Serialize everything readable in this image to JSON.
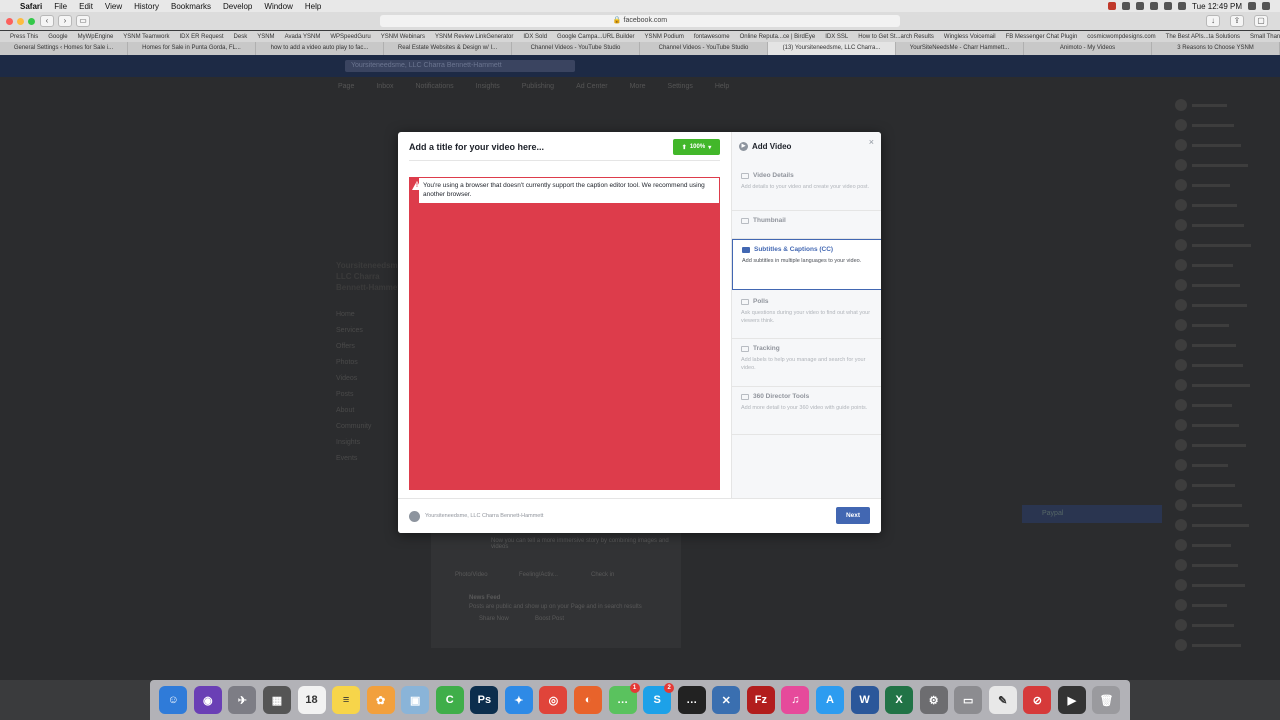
{
  "menubar": {
    "app": "Safari",
    "items": [
      "File",
      "Edit",
      "View",
      "History",
      "Bookmarks",
      "Develop",
      "Window",
      "Help"
    ],
    "clock": "Tue 12:49 PM"
  },
  "browser": {
    "url": "facebook.com",
    "bookmarks": [
      "Press This",
      "Google",
      "MyWpEngine",
      "YSNM Teamwork",
      "IDX ER Request",
      "Desk",
      "YSNM",
      "Avada YSNM",
      "WPSpeedGuru",
      "YSNM Webinars",
      "YSNM Review LinkGenerator",
      "IDX Sold",
      "Google Campa...URL Builder",
      "YSNM Podium",
      "fontawesome",
      "Online Reputa...ce | BirdEye",
      "IDX SSL",
      "How to Get St...arch Results",
      "Wingless Voicemail",
      "FB Messenger Chat Plugin",
      "cosmicwompdesigns.com",
      "The Best APIs...ta Solutions",
      "Small Thanks with Google"
    ],
    "tabs": [
      {
        "label": "General Settings ‹ Homes for Sale i...",
        "active": false
      },
      {
        "label": "Homes for Sale in Punta Gorda, FL...",
        "active": false
      },
      {
        "label": "how to add a video auto play to fac...",
        "active": false
      },
      {
        "label": "Real Estate Websites & Design w/ I...",
        "active": false
      },
      {
        "label": "Channel Videos - YouTube Studio",
        "active": false
      },
      {
        "label": "Channel Videos - YouTube Studio",
        "active": false
      },
      {
        "label": "(13) Yoursiteneedsme, LLC Charra...",
        "active": true
      },
      {
        "label": "YourSiteNeedsMe - Charr Hammett...",
        "active": false
      },
      {
        "label": "Animoto - My Videos",
        "active": false
      },
      {
        "label": "3 Reasons to Choose YSNM",
        "active": false
      }
    ]
  },
  "fb_background": {
    "search_placeholder": "Yoursiteneedsme, LLC Charra Bennett-Hammett",
    "tabs": [
      "Page",
      "Inbox",
      "Notifications",
      "Insights",
      "Publishing",
      "Ad Center",
      "More",
      "Settings",
      "Help"
    ],
    "page_name": "Yoursiteneedsme, LLC Charra Bennett-Hammett",
    "side_items": [
      "Home",
      "Services",
      "Offers",
      "Photos",
      "Videos",
      "Posts",
      "About",
      "Community",
      "Insights",
      "Events"
    ],
    "compose_text": "Now you can tell a more immersive story by combining images and videos",
    "compose_actions": [
      "Photo/Video",
      "Feeling/Activ...",
      "Check in"
    ],
    "news_feed_title": "News Feed",
    "news_feed_desc": "Posts are public and show up on your Page and in search results",
    "share_now": "Share Now",
    "boost_post": "Boost Post",
    "chat_title": "Paypal"
  },
  "modal": {
    "title": "Add a title for your video here...",
    "upload_progress": "100%",
    "warning": "You're using a browser that doesn't currently support the caption editor tool. We recommend using another browser.",
    "panel_title": "Add Video",
    "steps": [
      {
        "title": "Video Details",
        "desc": "Add details to your video and create your video post.",
        "active": false
      },
      {
        "title": "Thumbnail",
        "desc": "",
        "active": false
      },
      {
        "title": "Subtitles & Captions (CC)",
        "desc": "Add subtitles in multiple languages to your video.",
        "active": true
      },
      {
        "title": "Polls",
        "desc": "Ask questions during your video to find out what your viewers think.",
        "active": false
      },
      {
        "title": "Tracking",
        "desc": "Add labels to help you manage and search for your video.",
        "active": false
      },
      {
        "title": "360 Director Tools",
        "desc": "Add more detail to your 360 video with guide points.",
        "active": false
      }
    ],
    "footer_page": "Yoursiteneedsme, LLC Charra Bennett-Hammett",
    "next_label": "Next"
  },
  "dock": {
    "icons": [
      {
        "name": "finder-icon",
        "glyph": "☺",
        "color": "#2f7bd9"
      },
      {
        "name": "siri-icon",
        "glyph": "◉",
        "color": "#6a3fb5"
      },
      {
        "name": "launchpad-icon",
        "glyph": "✈",
        "color": "#7d7d85"
      },
      {
        "name": "calculator-icon",
        "glyph": "▦",
        "color": "#555"
      },
      {
        "name": "calendar-icon",
        "glyph": "18",
        "color": "#f2f2f2"
      },
      {
        "name": "notes-icon",
        "glyph": "≡",
        "color": "#f7d54a"
      },
      {
        "name": "photos-icon",
        "glyph": "✿",
        "color": "#f2a03d"
      },
      {
        "name": "preview-icon",
        "glyph": "▣",
        "color": "#8ab4d8"
      },
      {
        "name": "camtasia-icon",
        "glyph": "C",
        "color": "#3fae49"
      },
      {
        "name": "photoshop-icon",
        "glyph": "Ps",
        "color": "#0c2e4d"
      },
      {
        "name": "safari-icon",
        "glyph": "✦",
        "color": "#2e8ae6"
      },
      {
        "name": "chrome-icon",
        "glyph": "◎",
        "color": "#e0443a"
      },
      {
        "name": "firefox-icon",
        "glyph": "◐",
        "color": "#e8632b"
      },
      {
        "name": "messages-icon",
        "glyph": "…",
        "color": "#5ac25e"
      },
      {
        "name": "skype-icon",
        "glyph": "S",
        "color": "#1da1e8"
      },
      {
        "name": "chat-bubble-icon",
        "glyph": "…",
        "color": "#222"
      },
      {
        "name": "network-icon",
        "glyph": "✕",
        "color": "#3a6fb0"
      },
      {
        "name": "filezilla-icon",
        "glyph": "Fz",
        "color": "#b21d1d"
      },
      {
        "name": "itunes-icon",
        "glyph": "♫",
        "color": "#e64a9b"
      },
      {
        "name": "app-store-icon",
        "glyph": "A",
        "color": "#2d9cf0"
      },
      {
        "name": "word-icon",
        "glyph": "W",
        "color": "#2b579a"
      },
      {
        "name": "excel-icon",
        "glyph": "X",
        "color": "#217346"
      },
      {
        "name": "system-prefs-icon",
        "glyph": "⚙",
        "color": "#6d6d70"
      },
      {
        "name": "scanner-icon",
        "glyph": "▭",
        "color": "#8c8c90"
      },
      {
        "name": "textedit-icon",
        "glyph": "✎",
        "color": "#e8e8e8"
      },
      {
        "name": "no-entry-icon",
        "glyph": "⊘",
        "color": "#d63a3a"
      },
      {
        "name": "screen-recorder-icon",
        "glyph": "▶",
        "color": "#333"
      },
      {
        "name": "trash-icon",
        "glyph": "🗑",
        "color": "#9a9a9e"
      }
    ],
    "badges": {
      "messages-icon": "1",
      "skype-icon": "2"
    }
  }
}
